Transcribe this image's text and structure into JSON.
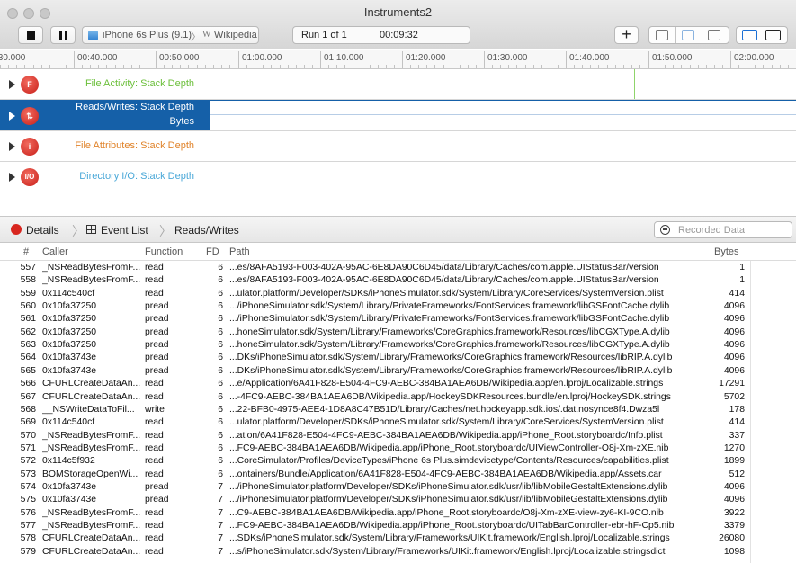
{
  "window": {
    "title": "Instruments2"
  },
  "toolbar": {
    "target_device": "iPhone 6s Plus (9.1)",
    "target_separator": "〉",
    "target_app_glyph": "W",
    "target_app": "Wikipedia",
    "run_label": "Run 1 of 1",
    "run_time": "00:09:32",
    "add_symbol": "+"
  },
  "ruler": {
    "ticks": [
      ":30.000",
      "00:40.000",
      "00:50.000",
      "01:00.000",
      "01:10.000",
      "01:20.000",
      "01:30.000",
      "01:40.000",
      "01:50.000",
      "02:00.000"
    ]
  },
  "tracks": [
    {
      "name": "File Activity: Stack Depth",
      "icon": "F",
      "color": "#6bbf3a"
    },
    {
      "name_line1": "Reads/Writes: Stack Depth",
      "name_line2": "Bytes",
      "icon": "⇅",
      "color": "#ffffff"
    },
    {
      "name": "File Attributes: Stack Depth",
      "icon": "i",
      "color": "#e0832a"
    },
    {
      "name": "Directory I/O: Stack Depth",
      "icon": "I/O",
      "color": "#4aa8d8"
    }
  ],
  "detail_bar": {
    "details": "Details",
    "event_list": "Event List",
    "reads_writes": "Reads/Writes",
    "chevron": "〉",
    "search_placeholder": "Recorded Data"
  },
  "table": {
    "headers": {
      "num": "#",
      "caller": "Caller",
      "function": "Function",
      "fd": "FD",
      "path": "Path",
      "bytes": "Bytes"
    },
    "rows": [
      [
        "557",
        "_NSReadBytesFromF...",
        "read",
        "6",
        "...es/8AFA5193-F003-402A-95AC-6E8DA90C6D45/data/Library/Caches/com.apple.UIStatusBar/version",
        "1"
      ],
      [
        "558",
        "_NSReadBytesFromF...",
        "read",
        "6",
        "...es/8AFA5193-F003-402A-95AC-6E8DA90C6D45/data/Library/Caches/com.apple.UIStatusBar/version",
        "1"
      ],
      [
        "559",
        "0x114c540cf",
        "read",
        "6",
        "...ulator.platform/Developer/SDKs/iPhoneSimulator.sdk/System/Library/CoreServices/SystemVersion.plist",
        "414"
      ],
      [
        "560",
        "0x10fa37250",
        "pread",
        "6",
        ".../iPhoneSimulator.sdk/System/Library/PrivateFrameworks/FontServices.framework/libGSFontCache.dylib",
        "4096"
      ],
      [
        "561",
        "0x10fa37250",
        "pread",
        "6",
        ".../iPhoneSimulator.sdk/System/Library/PrivateFrameworks/FontServices.framework/libGSFontCache.dylib",
        "4096"
      ],
      [
        "562",
        "0x10fa37250",
        "pread",
        "6",
        "...honeSimulator.sdk/System/Library/Frameworks/CoreGraphics.framework/Resources/libCGXType.A.dylib",
        "4096"
      ],
      [
        "563",
        "0x10fa37250",
        "pread",
        "6",
        "...honeSimulator.sdk/System/Library/Frameworks/CoreGraphics.framework/Resources/libCGXType.A.dylib",
        "4096"
      ],
      [
        "564",
        "0x10fa3743e",
        "pread",
        "6",
        "...DKs/iPhoneSimulator.sdk/System/Library/Frameworks/CoreGraphics.framework/Resources/libRIP.A.dylib",
        "4096"
      ],
      [
        "565",
        "0x10fa3743e",
        "pread",
        "6",
        "...DKs/iPhoneSimulator.sdk/System/Library/Frameworks/CoreGraphics.framework/Resources/libRIP.A.dylib",
        "4096"
      ],
      [
        "566",
        "CFURLCreateDataAn...",
        "read",
        "6",
        "...e/Application/6A41F828-E504-4FC9-AEBC-384BA1AEA6DB/Wikipedia.app/en.lproj/Localizable.strings",
        "17291"
      ],
      [
        "567",
        "CFURLCreateDataAn...",
        "read",
        "6",
        "...-4FC9-AEBC-384BA1AEA6DB/Wikipedia.app/HockeySDKResources.bundle/en.lproj/HockeySDK.strings",
        "5702"
      ],
      [
        "568",
        "__NSWriteDataToFil...",
        "write",
        "6",
        "...22-BFB0-4975-AEE4-1D8A8C47B51D/Library/Caches/net.hockeyapp.sdk.ios/.dat.nosynce8f4.Dwza5l",
        "178"
      ],
      [
        "569",
        "0x114c540cf",
        "read",
        "6",
        "...ulator.platform/Developer/SDKs/iPhoneSimulator.sdk/System/Library/CoreServices/SystemVersion.plist",
        "414"
      ],
      [
        "570",
        "_NSReadBytesFromF...",
        "read",
        "6",
        "...ation/6A41F828-E504-4FC9-AEBC-384BA1AEA6DB/Wikipedia.app/iPhone_Root.storyboardc/Info.plist",
        "337"
      ],
      [
        "571",
        "_NSReadBytesFromF...",
        "read",
        "6",
        "...FC9-AEBC-384BA1AEA6DB/Wikipedia.app/iPhone_Root.storyboardc/UIViewController-O8j-Xm-zXE.nib",
        "1270"
      ],
      [
        "572",
        "0x114c5f932",
        "read",
        "6",
        "...CoreSimulator/Profiles/DeviceTypes/iPhone 6s Plus.simdevicetype/Contents/Resources/capabilities.plist",
        "1899"
      ],
      [
        "573",
        "BOMStorageOpenWi...",
        "read",
        "6",
        "...ontainers/Bundle/Application/6A41F828-E504-4FC9-AEBC-384BA1AEA6DB/Wikipedia.app/Assets.car",
        "512"
      ],
      [
        "574",
        "0x10fa3743e",
        "pread",
        "7",
        ".../iPhoneSimulator.platform/Developer/SDKs/iPhoneSimulator.sdk/usr/lib/libMobileGestaltExtensions.dylib",
        "4096"
      ],
      [
        "575",
        "0x10fa3743e",
        "pread",
        "7",
        ".../iPhoneSimulator.platform/Developer/SDKs/iPhoneSimulator.sdk/usr/lib/libMobileGestaltExtensions.dylib",
        "4096"
      ],
      [
        "576",
        "_NSReadBytesFromF...",
        "read",
        "7",
        "...C9-AEBC-384BA1AEA6DB/Wikipedia.app/iPhone_Root.storyboardc/O8j-Xm-zXE-view-zy6-KI-9CO.nib",
        "3922"
      ],
      [
        "577",
        "_NSReadBytesFromF...",
        "read",
        "7",
        "...FC9-AEBC-384BA1AEA6DB/Wikipedia.app/iPhone_Root.storyboardc/UITabBarController-ebr-hF-Cp5.nib",
        "3379"
      ],
      [
        "578",
        "CFURLCreateDataAn...",
        "read",
        "7",
        "...SDKs/iPhoneSimulator.sdk/System/Library/Frameworks/UIKit.framework/English.lproj/Localizable.strings",
        "26080"
      ],
      [
        "579",
        "CFURLCreateDataAn...",
        "read",
        "7",
        "...s/iPhoneSimulator.sdk/System/Library/Frameworks/UIKit.framework/English.lproj/Localizable.stringsdict",
        "1098"
      ]
    ]
  }
}
